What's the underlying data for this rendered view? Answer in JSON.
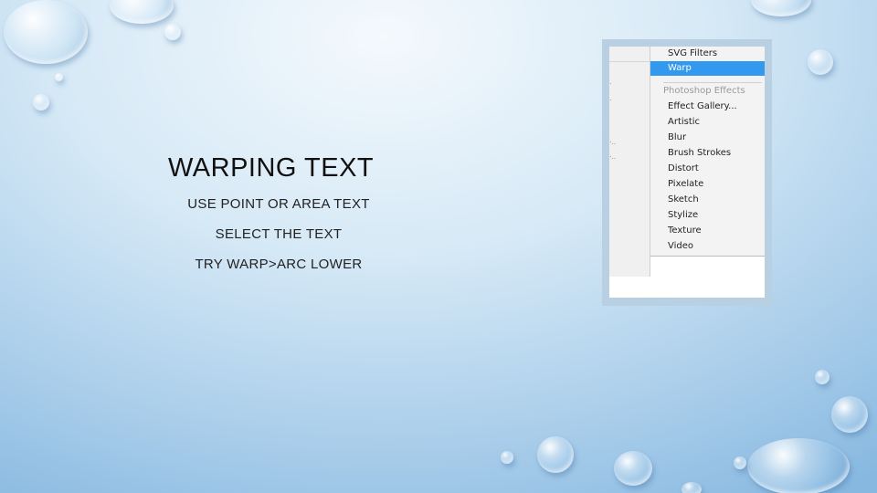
{
  "slide": {
    "title": "WARPING TEXT",
    "bullets": [
      "USE POINT OR AREA TEXT",
      "SELECT THE TEXT",
      "TRY  WARP>ARC LOWER"
    ]
  },
  "menu": {
    "items": [
      {
        "label": "SVG Filters",
        "selected": false
      },
      {
        "label": "Warp",
        "selected": true
      },
      {
        "label": "Photoshop Effects",
        "header": true
      },
      {
        "label": "Effect Gallery..."
      },
      {
        "label": "Artistic"
      },
      {
        "label": "Blur"
      },
      {
        "label": "Brush Strokes"
      },
      {
        "label": "Distort"
      },
      {
        "label": "Pixelate"
      },
      {
        "label": "Sketch"
      },
      {
        "label": "Stylize"
      },
      {
        "label": "Texture"
      },
      {
        "label": "Video"
      }
    ],
    "selection_color": "#3399ee"
  }
}
